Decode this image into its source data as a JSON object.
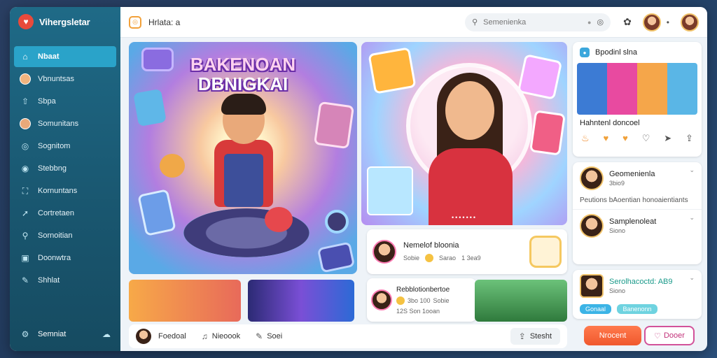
{
  "brand": {
    "name": "Vihergsletar",
    "logo_icon": "heart-icon"
  },
  "sidebar": {
    "items": [
      {
        "label": "Nbaat",
        "icon": "home-icon",
        "active": true
      },
      {
        "label": "Vbnuntsas",
        "icon": "avatar",
        "active": false
      },
      {
        "label": "Sbpa",
        "icon": "share-icon",
        "active": false
      },
      {
        "label": "Somunitans",
        "icon": "avatar",
        "active": false
      },
      {
        "label": "Sognitom",
        "icon": "chat-icon",
        "active": false
      },
      {
        "label": "Stebbng",
        "icon": "globe-icon",
        "active": false
      },
      {
        "label": "Kornuntans",
        "icon": "user-icon",
        "active": false
      },
      {
        "label": "Cortretaen",
        "icon": "arrow-icon",
        "active": false
      },
      {
        "label": "Sornoitian",
        "icon": "search-icon",
        "active": false
      },
      {
        "label": "Doonwtra",
        "icon": "bookmark-icon",
        "active": false
      },
      {
        "label": "Shhlat",
        "icon": "edit-icon",
        "active": false
      }
    ],
    "footer": {
      "label": "Semniat",
      "icon": "settings-icon",
      "right_icon": "cloud-icon"
    }
  },
  "topbar": {
    "page_title": "Hrlata: a",
    "search_placeholder": "Semenienka",
    "icons": [
      "search-icon",
      "mic-icon",
      "camera-icon",
      "notification-icon"
    ]
  },
  "hero_left": {
    "title_line1": "BAKENOAN",
    "title_line2": "DBNIGKAI"
  },
  "hero_right": {
    "dots": "•••••••"
  },
  "right_cards": {
    "featured": {
      "title": "Bpodinl slna",
      "caption": "Hahntenl doncoel",
      "reactions": [
        "fire-icon",
        "heart-icon",
        "heart-icon",
        "heart-outline-icon",
        "send-icon",
        "share-icon"
      ]
    },
    "person1": {
      "name": "Geomenienla",
      "meta": "3bio9",
      "desc": "Peutions bAoentian honoaientiants"
    },
    "person2": {
      "name": "Samplenoleat",
      "meta": "Siono"
    },
    "person3": {
      "name": "Serolhacoctd: AB9",
      "meta": "Siono",
      "tags": [
        "Gonaal",
        "Banenonn"
      ]
    }
  },
  "mid_cards": {
    "card1": {
      "title": "Nemelof bloonia",
      "meta1": "Sobie",
      "meta2": "Sarao",
      "meta3": "1 3ea9"
    },
    "card2": {
      "title": "Rebblotionbertoe",
      "meta1": "3bo 100",
      "meta2": "Sobie",
      "meta3": "12S Son 1ooan"
    }
  },
  "bottombar": {
    "user": "Foedoal",
    "action1": "Nieoook",
    "action2": "Soei",
    "share_label": "Stesht"
  },
  "buttons": {
    "primary": "Nrocent",
    "secondary": "Dooer"
  },
  "colors": {
    "sidebar": "#1f6a87",
    "active": "#2aa3c9",
    "accent_orange": "#f0582d",
    "accent_pink": "#d2529a"
  }
}
